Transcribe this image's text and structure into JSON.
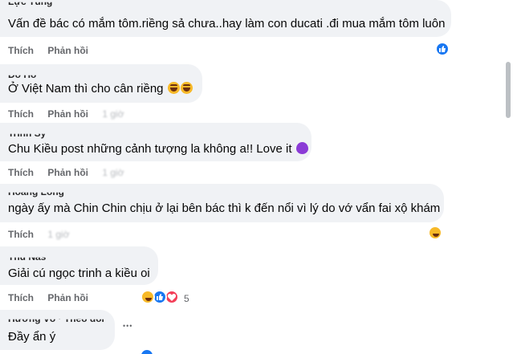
{
  "actions": {
    "like": "Thích",
    "reply": "Phản hồi",
    "more": "•••"
  },
  "comments": [
    {
      "author": "Lực Tùng",
      "text": "Vấn đề bác có mắm tôm.riềng sả chưa..hay làm con ducati .đi mua mắm tôm luôn",
      "time": "",
      "reactions": {
        "types": [
          "like-icon"
        ],
        "count": ""
      }
    },
    {
      "author": "Đỗ Hồ",
      "text": "Ở Việt Nam thì cho cân riềng",
      "emoji": [
        "laugh-emoji",
        "laugh-emoji"
      ],
      "time": "1 giờ"
    },
    {
      "author": "Trinh Sỹ",
      "text": "Chu Kiều post những cảnh tượng la không a!! Love it",
      "emoji": [
        "purple-heart-emoji"
      ],
      "time": "1 giờ"
    },
    {
      "author": "Hoàng Long",
      "text": "ngày ấy mà Chin Chin chịu ở lại bên bác thì k đến nổi vì lý do vớ vẩn fai xộ khám",
      "time": "1 giờ",
      "reactions": {
        "types": [
          "haha-icon"
        ],
        "count": ""
      }
    },
    {
      "author": "Thu Nas",
      "text": "Giải cú ngọc trinh a kiều oi",
      "time": "",
      "reactions": {
        "types": [
          "haha-icon",
          "like-icon",
          "heart-icon"
        ],
        "count": "5"
      }
    },
    {
      "author": "Hương Võ · Theo dõi",
      "text": "Đầy ẩn ý"
    }
  ],
  "colors": {
    "bubble": "#f0f2f5",
    "meta": "#65676b",
    "like_blue": "#1877f2",
    "heart_red": "#f33e58",
    "haha_yellow": "#f7b928"
  }
}
